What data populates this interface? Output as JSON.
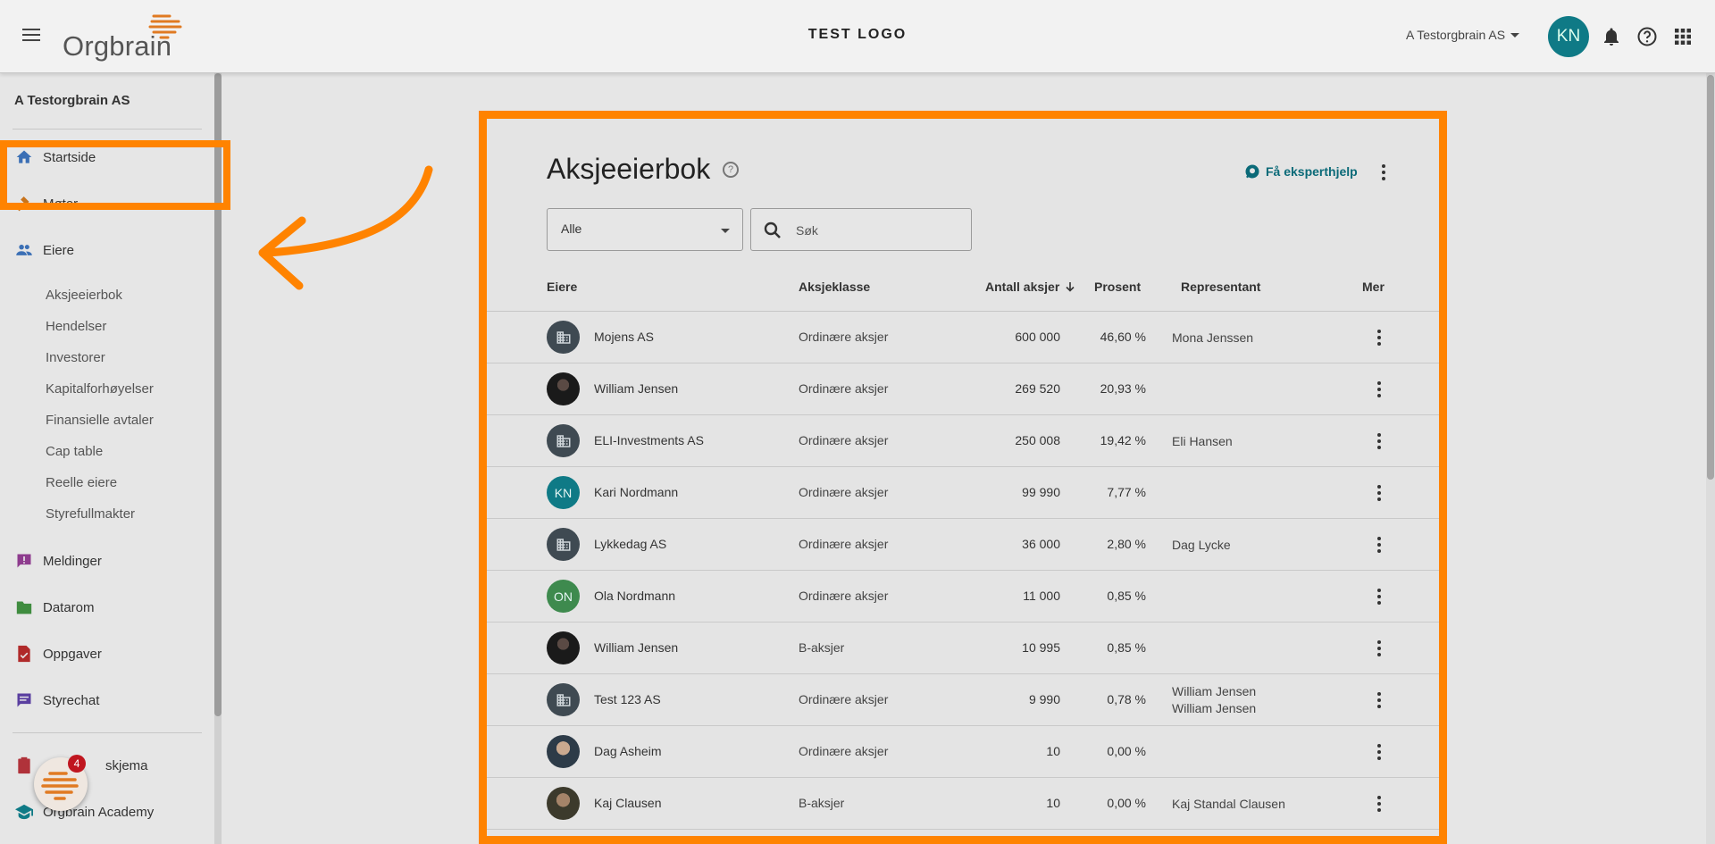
{
  "topbar": {
    "logo_text": "Orgbrain",
    "center_logo": "TEST LOGO",
    "org_selector": "A Testorgbrain AS",
    "avatar_initials": "KN"
  },
  "sidebar": {
    "company": "A Testorgbrain AS",
    "items": [
      {
        "label": "Startside",
        "icon": "home-icon"
      },
      {
        "label": "Møter",
        "icon": "gavel-icon"
      },
      {
        "label": "Eiere",
        "icon": "people-icon"
      }
    ],
    "sub_items": [
      "Aksjeeierbok",
      "Hendelser",
      "Investorer",
      "Kapitalforhøyelser",
      "Finansielle avtaler",
      "Cap table",
      "Reelle eiere",
      "Styrefullmakter"
    ],
    "items_after": [
      {
        "label": "Meldinger",
        "icon": "message-icon"
      },
      {
        "label": "Datarom",
        "icon": "folder-icon"
      },
      {
        "label": "Oppgaver",
        "icon": "task-icon"
      },
      {
        "label": "Styrechat",
        "icon": "chat-icon"
      }
    ],
    "bottom_items": [
      {
        "label": "skjema",
        "icon": "clipboard-icon"
      },
      {
        "label": "Orgbrain Academy",
        "icon": "school-icon"
      }
    ],
    "chat_badge": "4"
  },
  "main": {
    "title": "Aksjeeierbok",
    "expert_help": "Få eksperthjelp",
    "filter_value": "Alle",
    "search_placeholder": "Søk",
    "columns": {
      "owners": "Eiere",
      "share_class": "Aksjeklasse",
      "shares": "Antall aksjer",
      "percent": "Prosent",
      "representative": "Representant",
      "more": "Mer"
    },
    "rows": [
      {
        "name": "Mojens AS",
        "avatar": "org",
        "initials": "",
        "class": "Ordinære aksjer",
        "shares": "600 000",
        "percent": "46,60 %",
        "rep": [
          "Mona Jenssen"
        ]
      },
      {
        "name": "William Jensen",
        "avatar": "photo1",
        "initials": "",
        "class": "Ordinære aksjer",
        "shares": "269 520",
        "percent": "20,93 %",
        "rep": []
      },
      {
        "name": "ELI-Investments AS",
        "avatar": "org",
        "initials": "",
        "class": "Ordinære aksjer",
        "shares": "250 008",
        "percent": "19,42 %",
        "rep": [
          "Eli Hansen"
        ]
      },
      {
        "name": "Kari Nordmann",
        "avatar": "kn",
        "initials": "KN",
        "class": "Ordinære aksjer",
        "shares": "99 990",
        "percent": "7,77 %",
        "rep": []
      },
      {
        "name": "Lykkedag AS",
        "avatar": "org",
        "initials": "",
        "class": "Ordinære aksjer",
        "shares": "36 000",
        "percent": "2,80 %",
        "rep": [
          "Dag Lycke"
        ]
      },
      {
        "name": "Ola Nordmann",
        "avatar": "on",
        "initials": "ON",
        "class": "Ordinære aksjer",
        "shares": "11 000",
        "percent": "0,85 %",
        "rep": []
      },
      {
        "name": "William Jensen",
        "avatar": "photo1",
        "initials": "",
        "class": "B-aksjer",
        "shares": "10 995",
        "percent": "0,85 %",
        "rep": []
      },
      {
        "name": "Test 123 AS",
        "avatar": "org",
        "initials": "",
        "class": "Ordinære aksjer",
        "shares": "9 990",
        "percent": "0,78 %",
        "rep": [
          "William Jensen",
          "William Jensen"
        ]
      },
      {
        "name": "Dag Asheim",
        "avatar": "photo2",
        "initials": "",
        "class": "Ordinære aksjer",
        "shares": "10",
        "percent": "0,00 %",
        "rep": []
      },
      {
        "name": "Kaj Clausen",
        "avatar": "photo3",
        "initials": "",
        "class": "B-aksjer",
        "shares": "10",
        "percent": "0,00 %",
        "rep": [
          "Kaj Standal Clausen"
        ]
      }
    ]
  },
  "colors": {
    "highlight": "#ff8300",
    "brand_teal": "#0f7a86"
  }
}
